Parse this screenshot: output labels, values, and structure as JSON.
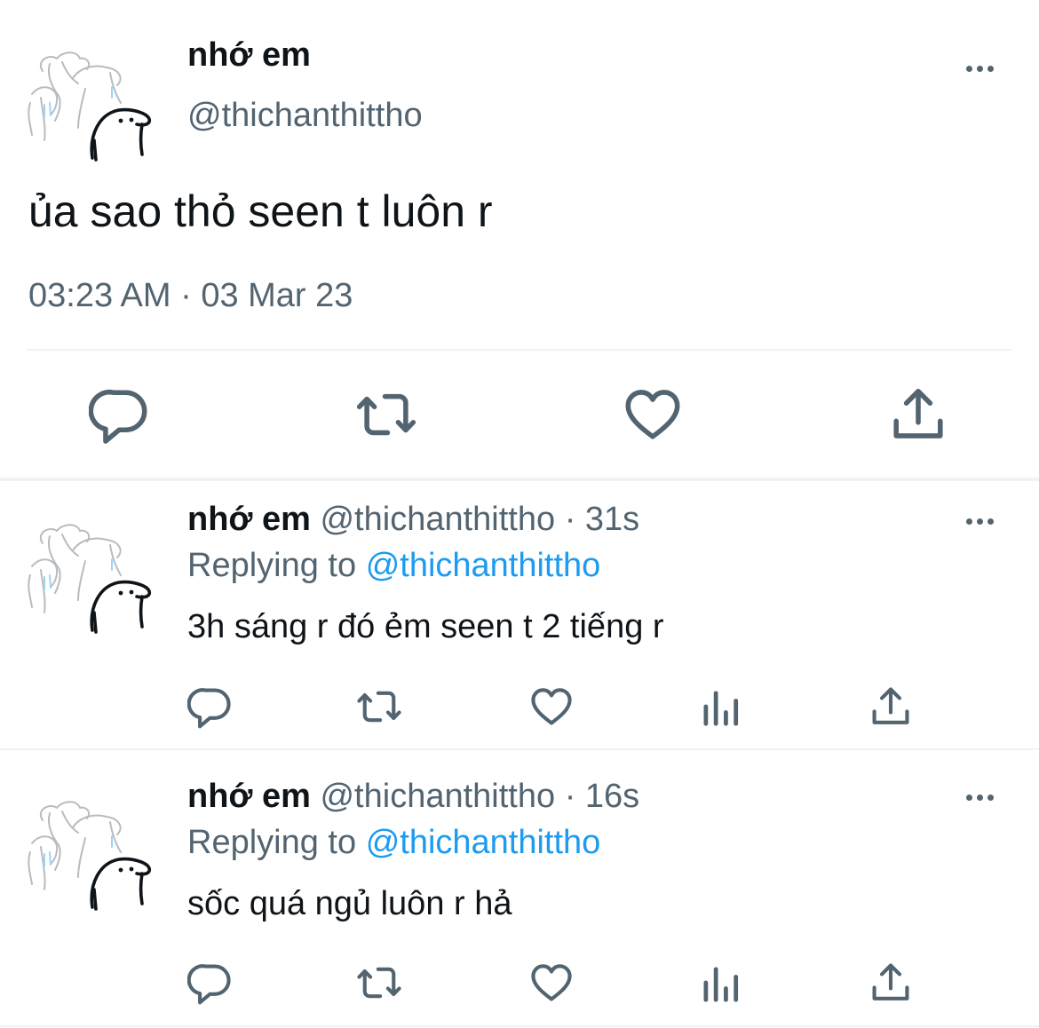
{
  "main_tweet": {
    "display_name": "nhớ em",
    "handle": "@thichanthittho",
    "text": "ủa sao thỏ seen t luôn r",
    "timestamp": "03:23 AM · 03 Mar 23"
  },
  "replies": [
    {
      "display_name": "nhớ em",
      "handle": "@thichanthittho",
      "time": "· 31s",
      "replying_prefix": "Replying to",
      "replying_handle": "@thichanthittho",
      "text": "3h sáng r đó ẻm seen t 2 tiếng r"
    },
    {
      "display_name": "nhớ em",
      "handle": "@thichanthittho",
      "time": "· 16s",
      "replying_prefix": "Replying to",
      "replying_handle": "@thichanthittho",
      "text": "sốc quá ngủ luôn r hả"
    }
  ],
  "icons": {
    "main_actions": [
      "reply-icon",
      "retweet-icon",
      "like-icon",
      "share-icon"
    ],
    "reply_actions": [
      "reply-icon",
      "retweet-icon",
      "like-icon",
      "analytics-icon",
      "share-icon"
    ],
    "menu": "more-icon"
  },
  "colors": {
    "text": "#0f1419",
    "secondary": "#536471",
    "link": "#1d9bf0",
    "divider": "#eff3f4"
  }
}
